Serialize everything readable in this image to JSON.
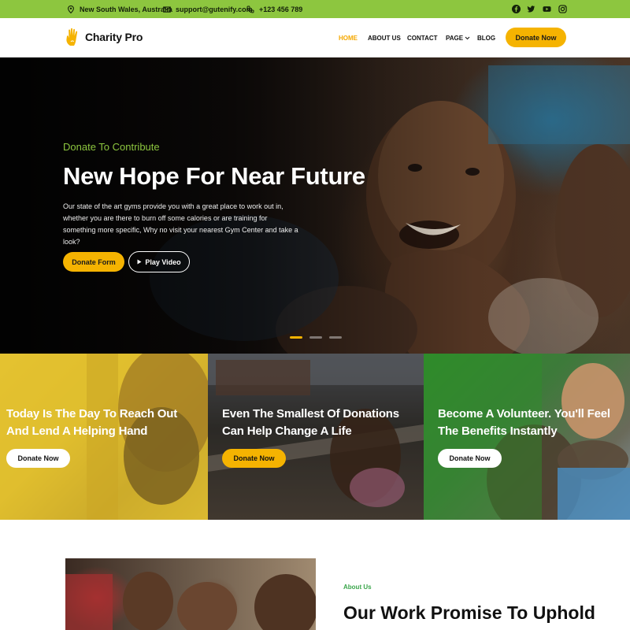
{
  "topbar": {
    "location": "New South Wales, Australia",
    "email": "support@gutenify.com",
    "phone": "+123 456 789",
    "social": [
      "facebook-icon",
      "twitter-icon",
      "youtube-icon",
      "instagram-icon"
    ]
  },
  "header": {
    "logo_text": "Charity Pro",
    "nav": [
      {
        "label": "HOME",
        "active": true
      },
      {
        "label": "ABOUT US",
        "active": false
      },
      {
        "label": "CONTACT",
        "active": false
      },
      {
        "label": "PAGE",
        "active": false
      },
      {
        "label": "BLOG",
        "active": false
      }
    ],
    "cta": "Donate Now"
  },
  "hero": {
    "subtitle": "Donate To Contribute",
    "title": "New Hope For Near Future",
    "text": "Our state of the art gyms provide you with a great place to work out in, whether you are there to burn off some calories or are training for something more specific, Why no visit your nearest Gym Center and take a look?",
    "primary_button": "Donate Form",
    "secondary_button": "Play Video"
  },
  "cards": [
    {
      "title": "Today Is The Day To Reach Out And Lend A Helping Hand",
      "button": "Donate Now"
    },
    {
      "title": "Even The Smallest Of Donations Can Help Change A Life",
      "button": "Donate Now"
    },
    {
      "title": "Become A Volunteer. You'll Feel The Benefits Instantly",
      "button": "Donate Now"
    }
  ],
  "about": {
    "subtitle": "About Us",
    "title": "Our Work Promise To Uphold"
  },
  "colors": {
    "brand_green": "#8dc63f",
    "accent_yellow": "#f5b301",
    "about_green": "#3aa64b"
  }
}
